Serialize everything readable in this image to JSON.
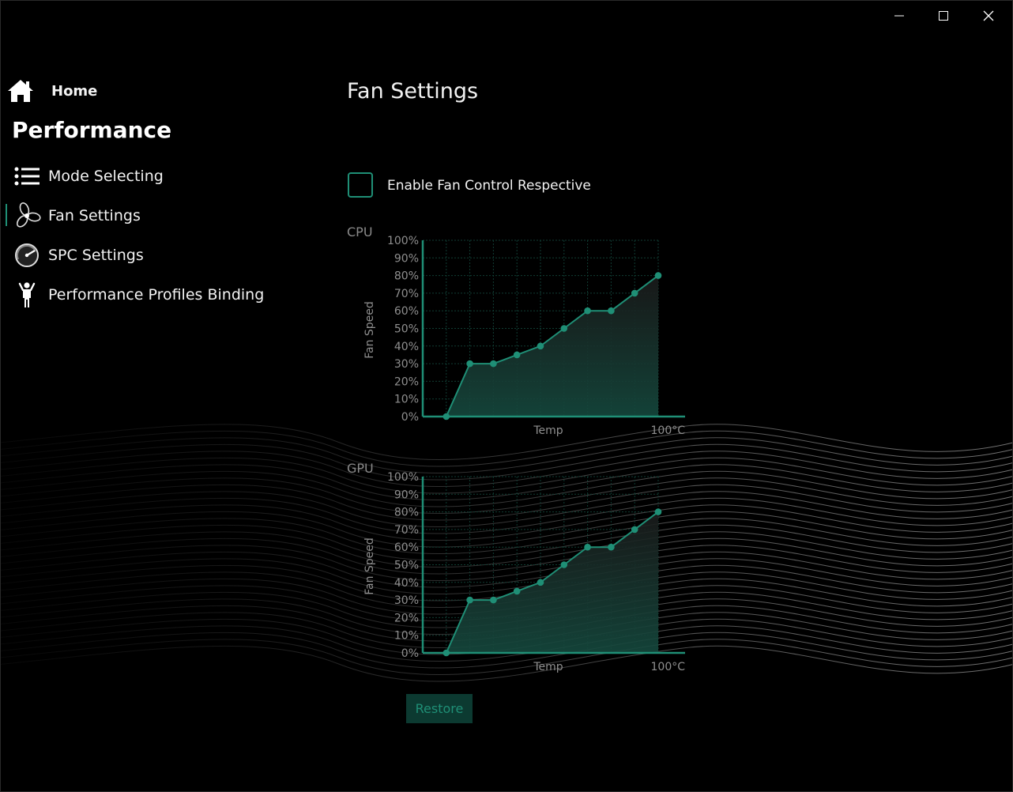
{
  "window": {
    "controls": [
      {
        "name": "minimize",
        "icon": "minimize-icon"
      },
      {
        "name": "maximize",
        "icon": "maximize-icon"
      },
      {
        "name": "close",
        "icon": "close-icon"
      }
    ]
  },
  "sidebar": {
    "home_label": "Home",
    "home_icon": "home-icon",
    "section_title": "Performance",
    "items": [
      {
        "label": "Mode Selecting",
        "icon": "list-icon",
        "active": false
      },
      {
        "label": "Fan Settings",
        "icon": "fan-icon",
        "active": true
      },
      {
        "label": "SPC Settings",
        "icon": "gauge-icon",
        "active": false
      },
      {
        "label": "Performance Profiles Binding",
        "icon": "person-icon",
        "active": false
      }
    ]
  },
  "main": {
    "title": "Fan Settings",
    "checkbox": {
      "label": "Enable Fan Control Respective",
      "checked": false
    },
    "restore_label": "Restore"
  },
  "colors": {
    "accent": "#1f8f76",
    "background": "#000000",
    "grid": "#103d33",
    "tick_text": "#8f8f8f"
  },
  "chart_data": [
    {
      "type": "area",
      "title": "CPU",
      "xlabel": "Temp",
      "ylabel": "Fan Speed",
      "x_end_label": "100°C",
      "yticks": [
        "0%",
        "10%",
        "20%",
        "30%",
        "40%",
        "50%",
        "60%",
        "70%",
        "80%",
        "90%",
        "100%"
      ],
      "ylim": [
        0,
        100
      ],
      "xlim": [
        0,
        100
      ],
      "x": [
        10,
        20,
        30,
        40,
        50,
        60,
        70,
        80,
        90,
        100
      ],
      "series": [
        {
          "values": [
            0,
            30,
            30,
            35,
            40,
            50,
            60,
            60,
            70,
            80
          ]
        }
      ],
      "grid": true
    },
    {
      "type": "area",
      "title": "GPU",
      "xlabel": "Temp",
      "ylabel": "Fan Speed",
      "x_end_label": "100°C",
      "yticks": [
        "0%",
        "10%",
        "20%",
        "30%",
        "40%",
        "50%",
        "60%",
        "70%",
        "80%",
        "90%",
        "100%"
      ],
      "ylim": [
        0,
        100
      ],
      "xlim": [
        0,
        100
      ],
      "x": [
        10,
        20,
        30,
        40,
        50,
        60,
        70,
        80,
        90,
        100
      ],
      "series": [
        {
          "values": [
            0,
            30,
            30,
            35,
            40,
            50,
            60,
            60,
            70,
            80
          ]
        }
      ],
      "grid": true
    }
  ]
}
